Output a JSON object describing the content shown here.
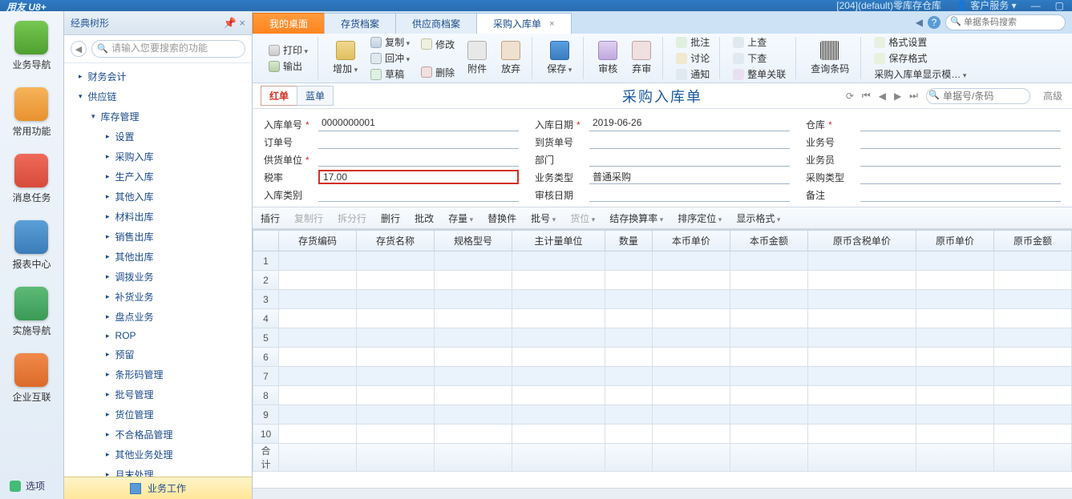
{
  "titlebar": {
    "brand": "用友 U8+",
    "account": "[204](default)零库存仓库",
    "service": "客户服务"
  },
  "launcher": {
    "items": [
      {
        "label": "业务导航",
        "cls": "ic-green"
      },
      {
        "label": "常用功能",
        "cls": "ic-orange"
      },
      {
        "label": "消息任务",
        "cls": "ic-red"
      },
      {
        "label": "报表中心",
        "cls": "ic-blue"
      },
      {
        "label": "实施导航",
        "cls": "ic-dgreen"
      },
      {
        "label": "企业互联",
        "cls": "ic-dorange"
      }
    ],
    "footer": "选项"
  },
  "treepanel": {
    "title": "经典树形",
    "search_ph": "请输入您要搜索的功能",
    "nodes": [
      {
        "label": "财务会计",
        "lvl": 0,
        "state": "collapsed"
      },
      {
        "label": "供应链",
        "lvl": 0,
        "state": "expanded"
      },
      {
        "label": "库存管理",
        "lvl": 1,
        "state": "expanded"
      },
      {
        "label": "设置",
        "lvl": 2,
        "state": "collapsed"
      },
      {
        "label": "采购入库",
        "lvl": 2,
        "state": "collapsed"
      },
      {
        "label": "生产入库",
        "lvl": 2,
        "state": "collapsed"
      },
      {
        "label": "其他入库",
        "lvl": 2,
        "state": "collapsed"
      },
      {
        "label": "材料出库",
        "lvl": 2,
        "state": "collapsed"
      },
      {
        "label": "销售出库",
        "lvl": 2,
        "state": "collapsed"
      },
      {
        "label": "其他出库",
        "lvl": 2,
        "state": "collapsed"
      },
      {
        "label": "调拨业务",
        "lvl": 2,
        "state": "collapsed"
      },
      {
        "label": "补货业务",
        "lvl": 2,
        "state": "collapsed"
      },
      {
        "label": "盘点业务",
        "lvl": 2,
        "state": "collapsed"
      },
      {
        "label": "ROP",
        "lvl": 2,
        "state": "collapsed"
      },
      {
        "label": "预留",
        "lvl": 2,
        "state": "collapsed"
      },
      {
        "label": "条形码管理",
        "lvl": 2,
        "state": "collapsed"
      },
      {
        "label": "批号管理",
        "lvl": 2,
        "state": "collapsed"
      },
      {
        "label": "货位管理",
        "lvl": 2,
        "state": "collapsed"
      },
      {
        "label": "不合格品管理",
        "lvl": 2,
        "state": "collapsed"
      },
      {
        "label": "其他业务处理",
        "lvl": 2,
        "state": "collapsed"
      },
      {
        "label": "月末处理",
        "lvl": 2,
        "state": "collapsed"
      }
    ],
    "footer": "业务工作"
  },
  "tabs": {
    "items": [
      {
        "label": "我的桌面",
        "cls": "orange",
        "close": false
      },
      {
        "label": "存货档案",
        "cls": "",
        "close": false
      },
      {
        "label": "供应商档案",
        "cls": "",
        "close": false
      },
      {
        "label": "采购入库单",
        "cls": "active",
        "close": true
      }
    ],
    "search_ph": "单据条码搜索"
  },
  "ribbon": {
    "print": "打印",
    "export": "输出",
    "add": "增加",
    "copy": "复制",
    "back": "回冲",
    "draft": "草稿",
    "edit": "修改",
    "del": "删除",
    "attach": "附件",
    "drop": "放弃",
    "save": "保存",
    "audit": "审核",
    "aban": "弃审",
    "approve": "批注",
    "discuss": "讨论",
    "notify": "通知",
    "up": "上查",
    "down": "下查",
    "link": "整单关联",
    "barcode": "查询条码",
    "fmtset": "格式设置",
    "fmtsave": "保存格式",
    "display": "采购入库单显示模…"
  },
  "dochead": {
    "red": "红单",
    "blue": "蓝单",
    "title": "采购入库单",
    "search_ph": "单据号/条码",
    "adv": "高级"
  },
  "form": {
    "f1": {
      "label": "入库单号",
      "req": true,
      "val": "0000000001"
    },
    "f2": {
      "label": "入库日期",
      "req": true,
      "val": "2019-06-26"
    },
    "f3": {
      "label": "仓库",
      "req": true,
      "val": ""
    },
    "f4": {
      "label": "订单号",
      "req": false,
      "val": ""
    },
    "f5": {
      "label": "到货单号",
      "req": false,
      "val": ""
    },
    "f6": {
      "label": "业务号",
      "req": false,
      "val": ""
    },
    "f7": {
      "label": "供货单位",
      "req": true,
      "val": ""
    },
    "f8": {
      "label": "部门",
      "req": false,
      "val": ""
    },
    "f9": {
      "label": "业务员",
      "req": false,
      "val": ""
    },
    "f10": {
      "label": "税率",
      "req": false,
      "val": "17.00",
      "hl": true
    },
    "f11": {
      "label": "业务类型",
      "req": false,
      "val": "普通采购"
    },
    "f12": {
      "label": "采购类型",
      "req": false,
      "val": ""
    },
    "f13": {
      "label": "入库类别",
      "req": false,
      "val": ""
    },
    "f14": {
      "label": "审核日期",
      "req": false,
      "val": ""
    },
    "f15": {
      "label": "备注",
      "req": false,
      "val": ""
    }
  },
  "gridtb": {
    "insert": "插行",
    "copyrow": "复制行",
    "split": "拆分行",
    "delrow": "删行",
    "batchmod": "批改",
    "stock": "存量",
    "replace": "替换件",
    "batch": "批号",
    "loc": "货位",
    "conv": "结存换算率",
    "sort": "排序定位",
    "dispfmt": "显示格式"
  },
  "grid": {
    "cols": [
      "存货编码",
      "存货名称",
      "规格型号",
      "主计量单位",
      "数量",
      "本币单价",
      "本币金额",
      "原币含税单价",
      "原币单价",
      "原币金额"
    ],
    "rows": 10,
    "total": "合计"
  }
}
